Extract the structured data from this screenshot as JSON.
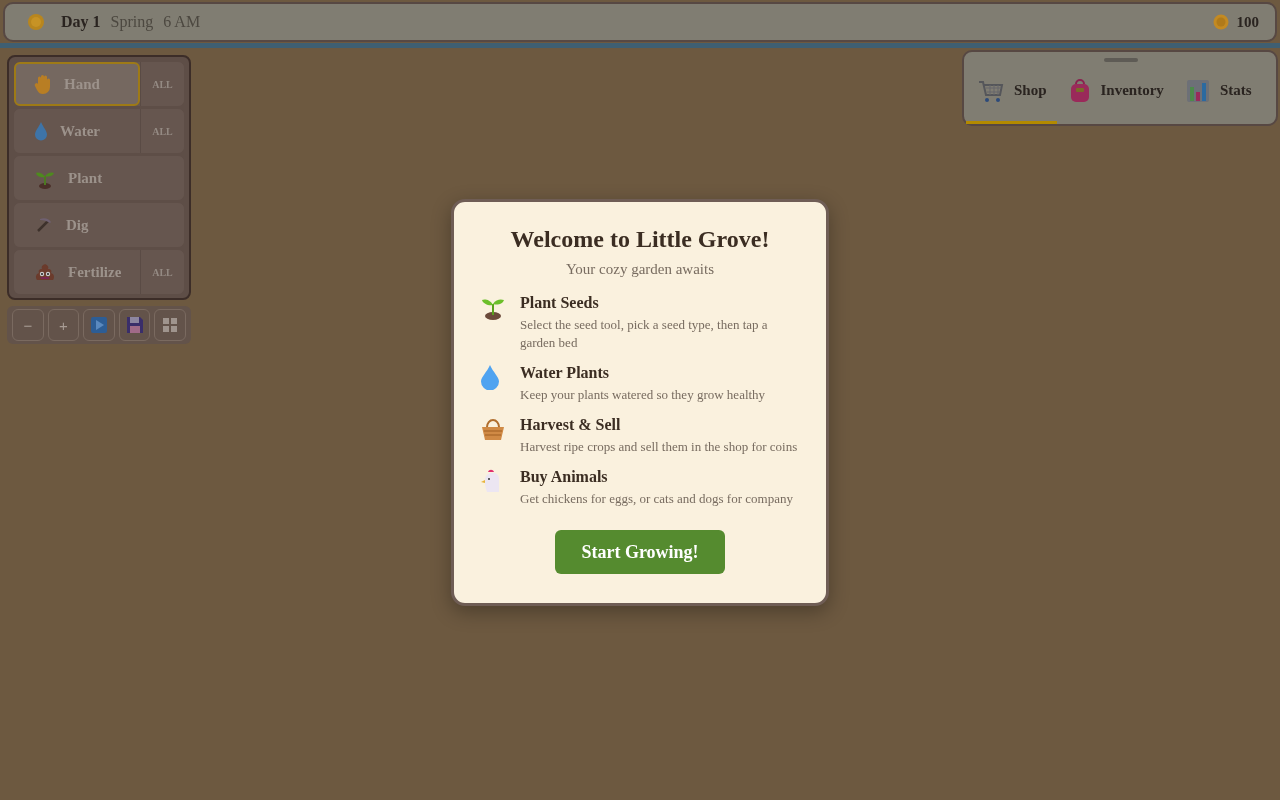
{
  "top_bar": {
    "day": "Day 1",
    "season": "Spring",
    "time": "6 AM",
    "coins": "100"
  },
  "tools": [
    {
      "kind": "hand",
      "label": "Hand",
      "selected": true,
      "all_label": "ALL"
    },
    {
      "kind": "water",
      "label": "Water",
      "selected": false,
      "all_label": "ALL"
    },
    {
      "kind": "plant",
      "label": "Plant",
      "selected": false
    },
    {
      "kind": "dig",
      "label": "Dig",
      "selected": false
    },
    {
      "kind": "fertilize",
      "label": "Fertilize",
      "selected": false,
      "all_label": "ALL"
    }
  ],
  "controls": [
    {
      "kind": "text",
      "label": "−"
    },
    {
      "kind": "text",
      "label": "+"
    },
    {
      "kind": "play"
    },
    {
      "kind": "save"
    },
    {
      "kind": "grid"
    }
  ],
  "tabs": [
    {
      "kind": "cart",
      "label": "Shop",
      "selected": true
    },
    {
      "kind": "bag",
      "label": "Inventory",
      "selected": false
    },
    {
      "kind": "chart",
      "label": "Stats",
      "selected": false
    }
  ],
  "dialog": {
    "title": "Welcome to Little Grove!",
    "subtitle": "Your cozy garden awaits",
    "features": [
      {
        "kind": "sprout",
        "title": "Plant Seeds",
        "text": "Select the seed tool, pick a seed type, then tap a garden bed"
      },
      {
        "kind": "drop",
        "title": "Water Plants",
        "text": "Keep your plants watered so they grow healthy"
      },
      {
        "kind": "basket",
        "title": "Harvest & Sell",
        "text": "Harvest ripe crops and sell them in the shop for coins"
      },
      {
        "kind": "chicken",
        "title": "Buy Animals",
        "text": "Get chickens for eggs, or cats and dogs for company"
      }
    ],
    "button": "Start Growing!"
  }
}
